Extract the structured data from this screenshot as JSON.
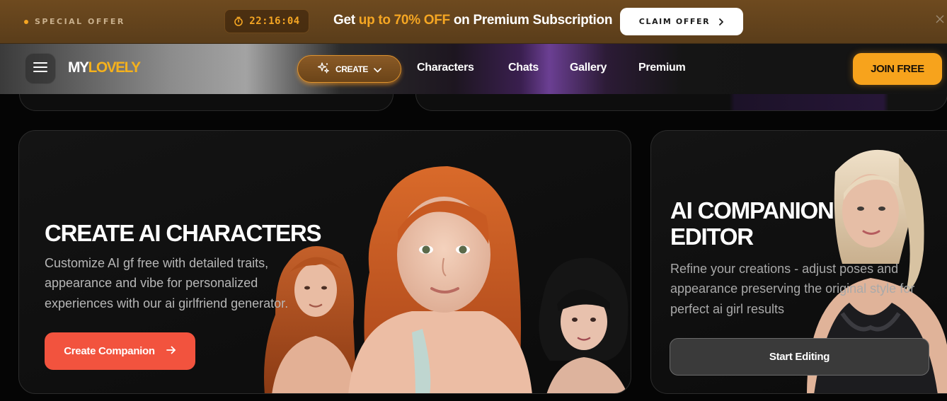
{
  "promo": {
    "tag": "SPECIAL OFFER",
    "timer": "22:16:04",
    "message_prefix": "Get ",
    "message_highlight": "up to 70% OFF",
    "message_suffix": " on Premium Subscription",
    "cta_label": "CLAIM OFFER",
    "cta_icon": "chevron-right-icon",
    "close_icon": "close-icon",
    "accent_color": "#f5a623"
  },
  "nav": {
    "menu_icon": "hamburger-icon",
    "logo_part1": "MY",
    "logo_part2": "LOVELY",
    "create_label": "CREATE",
    "create_icon": "sparkles-icon",
    "links": [
      "Characters",
      "Chats",
      "Gallery",
      "Premium"
    ],
    "join_label": "JOIN FREE",
    "join_color": "#f7a31c"
  },
  "cards": {
    "create": {
      "title": "CREATE AI CHARACTERS",
      "description": "Customize AI gf free with detailed traits, appearance and vibe for personalized experiences with our ai girlfriend generator.",
      "cta_label": "Create Companion",
      "cta_icon": "arrow-right-icon",
      "cta_color": "#f2533e"
    },
    "edit": {
      "title": "AI COMPANION EDITOR",
      "description": "Refine your creations - adjust poses and appearance preserving the original style for perfect ai girl results",
      "cta_label": "Start Editing"
    }
  }
}
